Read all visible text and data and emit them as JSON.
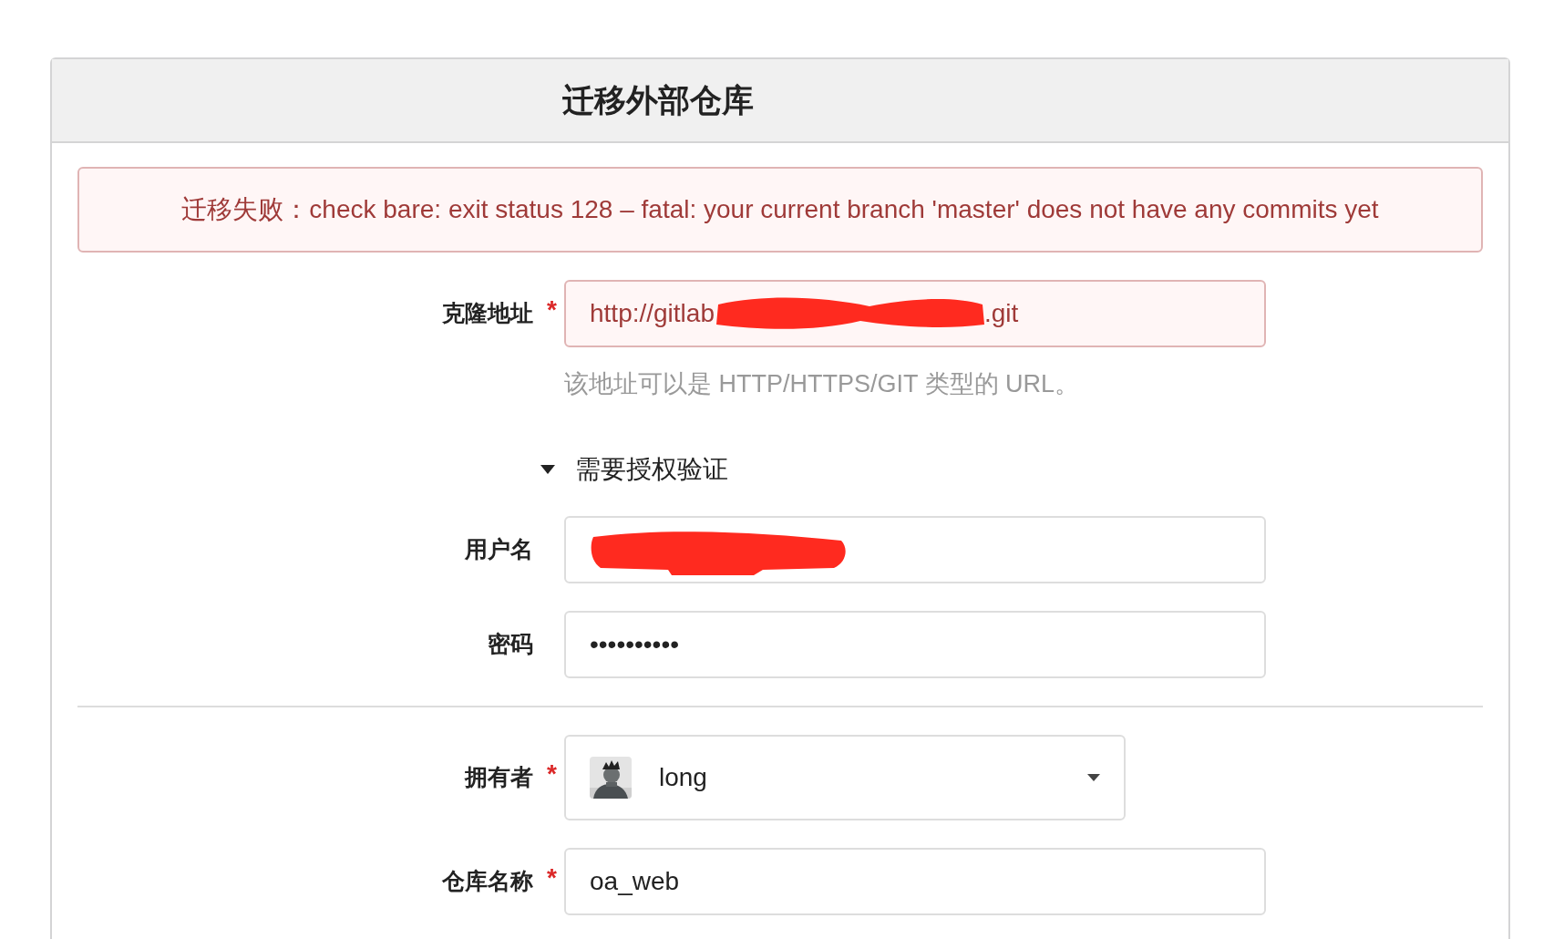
{
  "card": {
    "title": "迁移外部仓库"
  },
  "error": {
    "text": "迁移失败：check bare: exit status 128 – fatal: your current branch 'master' does not have any commits yet"
  },
  "fields": [
    {
      "kind": "url",
      "label": "克隆地址",
      "required_mark": "*",
      "error": true,
      "value_start": "http://gitlab",
      "value_end": ".git",
      "redacted": true,
      "help": "该地址可以是 HTTP/HTTPS/GIT 类型的 URL。"
    },
    {
      "kind": "toggle",
      "label": "需要授权验证",
      "expanded": true
    },
    {
      "kind": "text",
      "label": "用户名",
      "redacted": true
    },
    {
      "kind": "text",
      "label": "密码",
      "value": "••••••••••"
    },
    {
      "kind": "divider"
    },
    {
      "kind": "owner",
      "label": "拥有者",
      "required_mark": "*",
      "value": "long"
    },
    {
      "kind": "text",
      "label": "仓库名称",
      "required_mark": "*",
      "value": "oa_web"
    }
  ]
}
